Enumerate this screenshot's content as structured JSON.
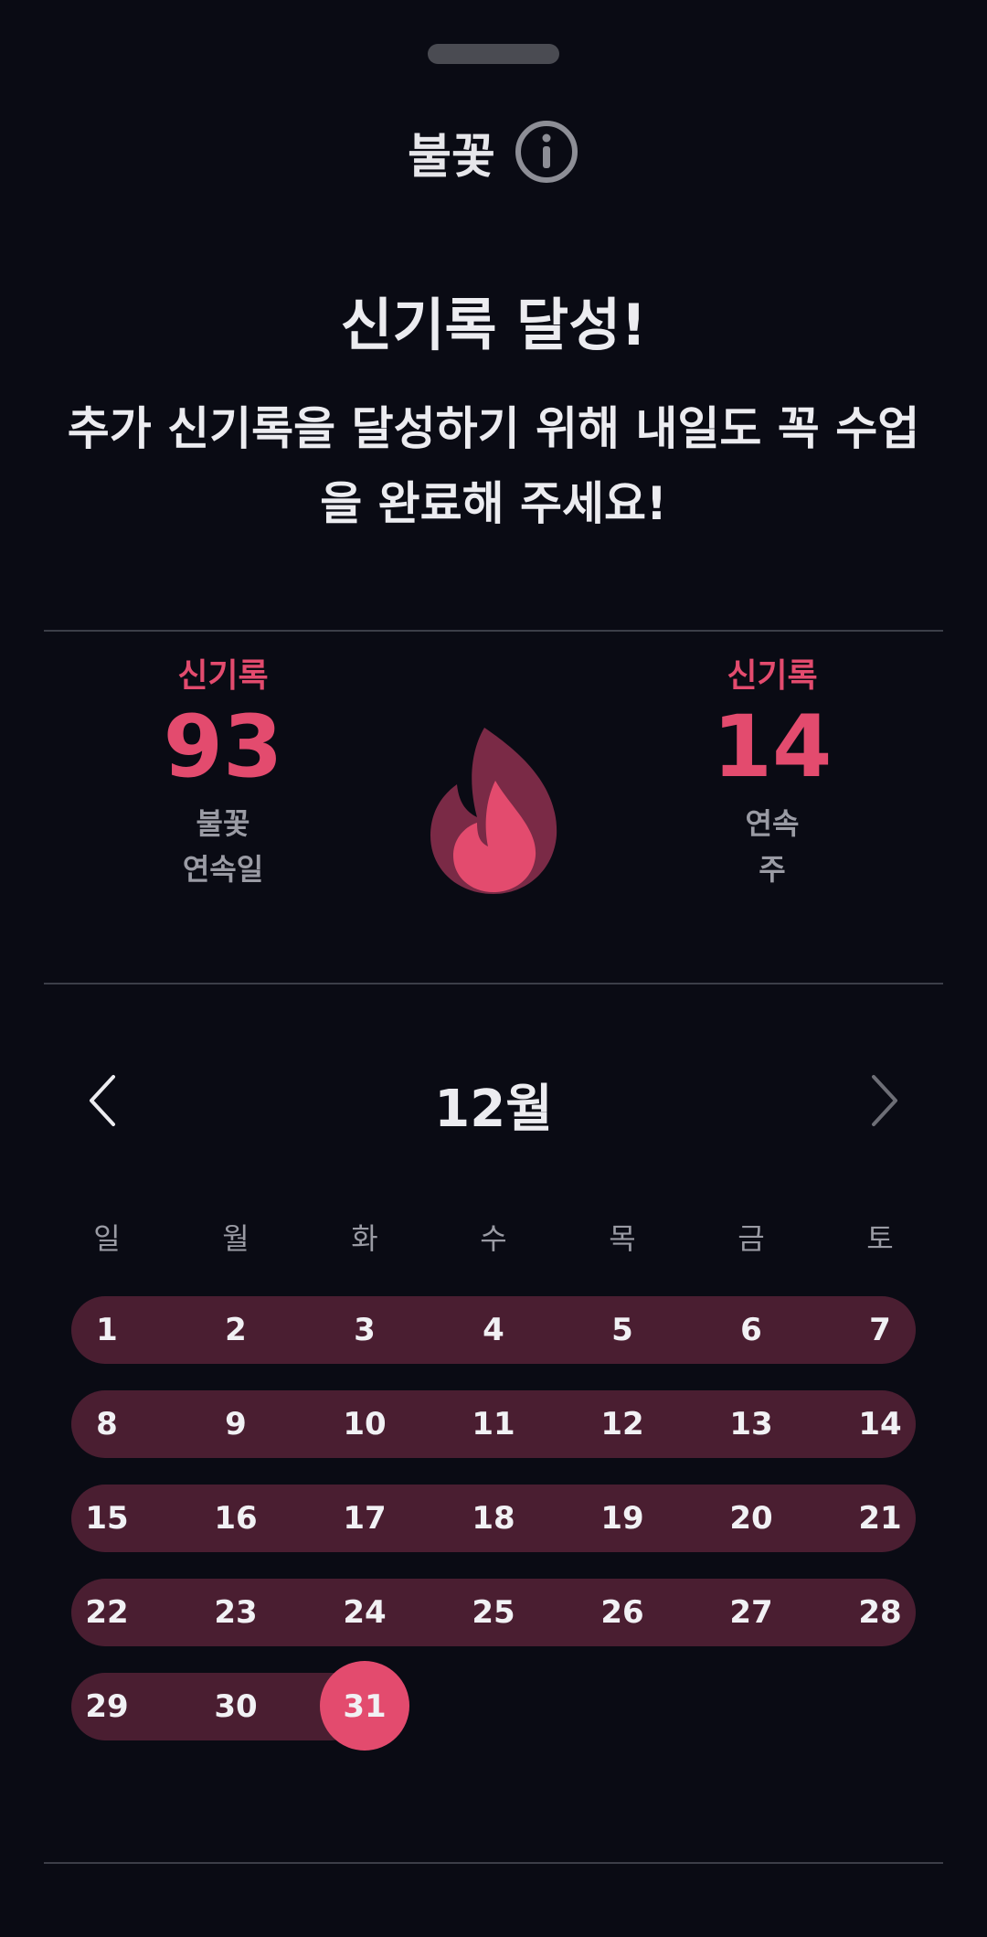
{
  "header": {
    "title": "불꽃",
    "info_icon": "info-circle-icon"
  },
  "message": {
    "headline": "신기록 달성!",
    "subline": "추가 신기록을 달성하기 위해 내일도 꼭 수업을 완료해 주세요!"
  },
  "stats": {
    "days": {
      "label": "신기록",
      "value": "93",
      "caption_line1": "불꽃",
      "caption_line2": "연속일"
    },
    "weeks": {
      "label": "신기록",
      "value": "14",
      "caption_line1": "연속",
      "caption_line2": "주"
    },
    "center_icon": "flame-icon"
  },
  "colors": {
    "accent": "#e34b6e",
    "streak_bar": "#4a1e31",
    "background": "#0a0b14"
  },
  "calendar": {
    "month_label": "12월",
    "prev_icon": "chevron-left-icon",
    "next_icon": "chevron-right-icon",
    "weekdays": [
      "일",
      "월",
      "화",
      "수",
      "목",
      "금",
      "토"
    ],
    "weeks": [
      [
        "1",
        "2",
        "3",
        "4",
        "5",
        "6",
        "7"
      ],
      [
        "8",
        "9",
        "10",
        "11",
        "12",
        "13",
        "14"
      ],
      [
        "15",
        "16",
        "17",
        "18",
        "19",
        "20",
        "21"
      ],
      [
        "22",
        "23",
        "24",
        "25",
        "26",
        "27",
        "28"
      ],
      [
        "29",
        "30",
        "31"
      ]
    ],
    "today": "31"
  }
}
